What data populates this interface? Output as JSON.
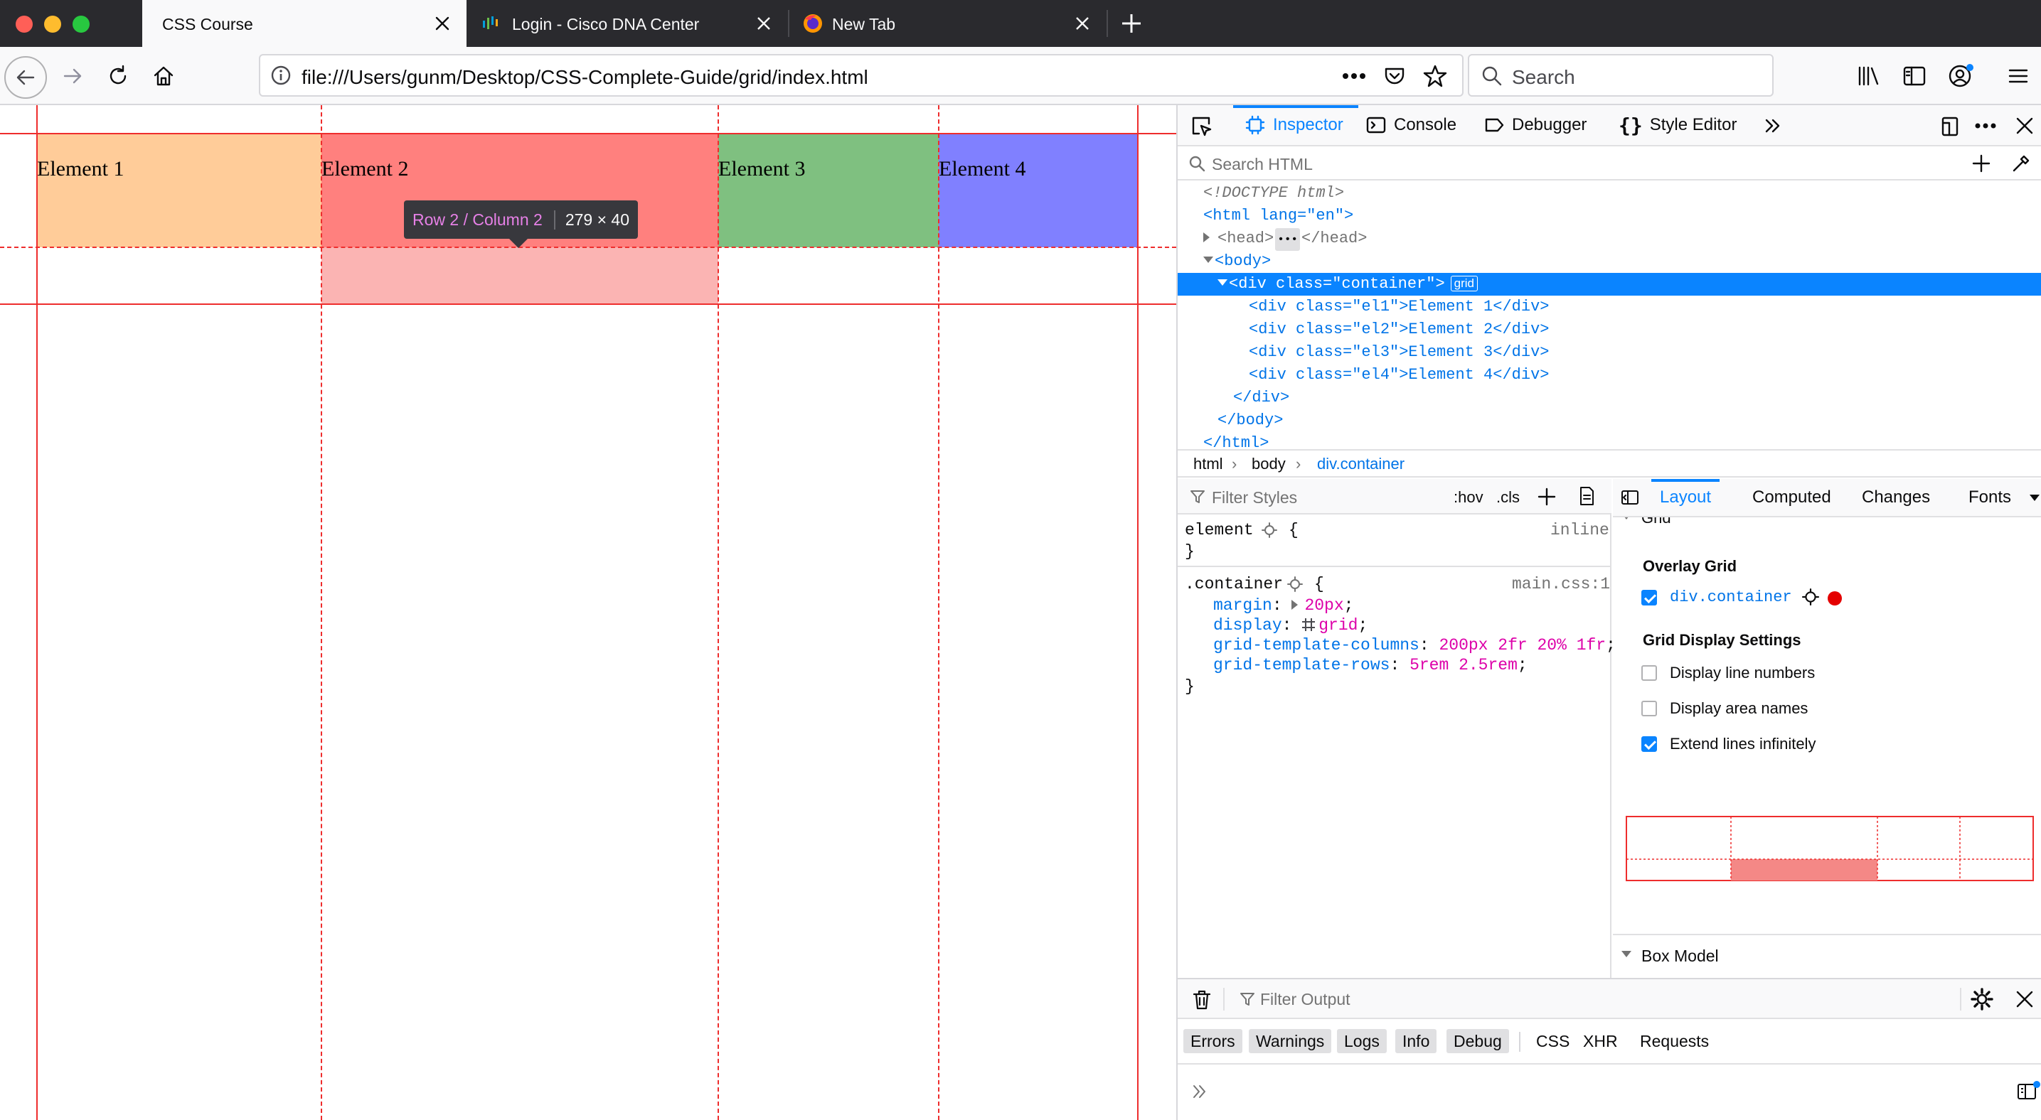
{
  "browser": {
    "tabs": [
      {
        "label": "CSS Course",
        "active": true
      },
      {
        "label": "Login - Cisco DNA Center",
        "active": false
      },
      {
        "label": "New Tab",
        "active": false
      }
    ],
    "url": "file:///Users/gunm/Desktop/CSS-Complete-Guide/grid/index.html",
    "search_placeholder": "Search"
  },
  "page": {
    "elements": [
      {
        "label": "Element 1",
        "color": "#ffcc99"
      },
      {
        "label": "Element 2",
        "color": "#ff807e"
      },
      {
        "label": "Element 3",
        "color": "#7fc080"
      },
      {
        "label": "Element 4",
        "color": "#8080ff"
      }
    ],
    "tooltip": {
      "area": "Row 2 / Column 2",
      "dims": "279 × 40"
    },
    "grid_line_color": "#ee2d2d",
    "highlight_color": "#fbb4b3"
  },
  "devtools": {
    "tabs": [
      "Inspector",
      "Console",
      "Debugger",
      "Style Editor"
    ],
    "search_html_placeholder": "Search HTML",
    "markup": {
      "doctype": "<!DOCTYPE html>",
      "html_open": "<html lang=\"en\">",
      "head": "<head>",
      "head_close": "</head>",
      "body_open": "<body>",
      "container_open": "<div class=\"container\">",
      "grid_badge": "grid",
      "children": [
        "<div class=\"el1\">Element 1</div>",
        "<div class=\"el2\">Element 2</div>",
        "<div class=\"el3\">Element 3</div>",
        "<div class=\"el4\">Element 4</div>"
      ],
      "div_close": "</div>",
      "body_close": "</body>",
      "html_close": "</html>"
    },
    "breadcrumbs": [
      "html",
      "body",
      "div.container"
    ],
    "rules": {
      "filter_placeholder": "Filter Styles",
      "hov": ":hov",
      "cls": ".cls",
      "element_selector": "element",
      "element_source": "inline",
      "container_selector": ".container",
      "container_source": "main.css:1",
      "declarations": [
        {
          "prop": "margin",
          "value": "20px"
        },
        {
          "prop": "display",
          "value": "grid"
        },
        {
          "prop": "grid-template-columns",
          "value": "200px 2fr 20% 1fr"
        },
        {
          "prop": "grid-template-rows",
          "value": "5rem 2.5rem"
        }
      ]
    },
    "layout": {
      "tabs": [
        "Layout",
        "Computed",
        "Changes",
        "Fonts"
      ],
      "grid_section_label": "Grid",
      "overlay_grid_heading": "Overlay Grid",
      "overlay_item": "div.container",
      "overlay_color": "#e40000",
      "settings_heading": "Grid Display Settings",
      "settings": [
        {
          "label": "Display line numbers",
          "checked": false
        },
        {
          "label": "Display area names",
          "checked": false
        },
        {
          "label": "Extend lines infinitely",
          "checked": true
        }
      ],
      "box_model_label": "Box Model"
    },
    "console": {
      "filter_placeholder": "Filter Output",
      "filters": [
        "Errors",
        "Warnings",
        "Logs",
        "Info",
        "Debug"
      ],
      "categories": [
        "CSS",
        "XHR",
        "Requests"
      ]
    }
  }
}
